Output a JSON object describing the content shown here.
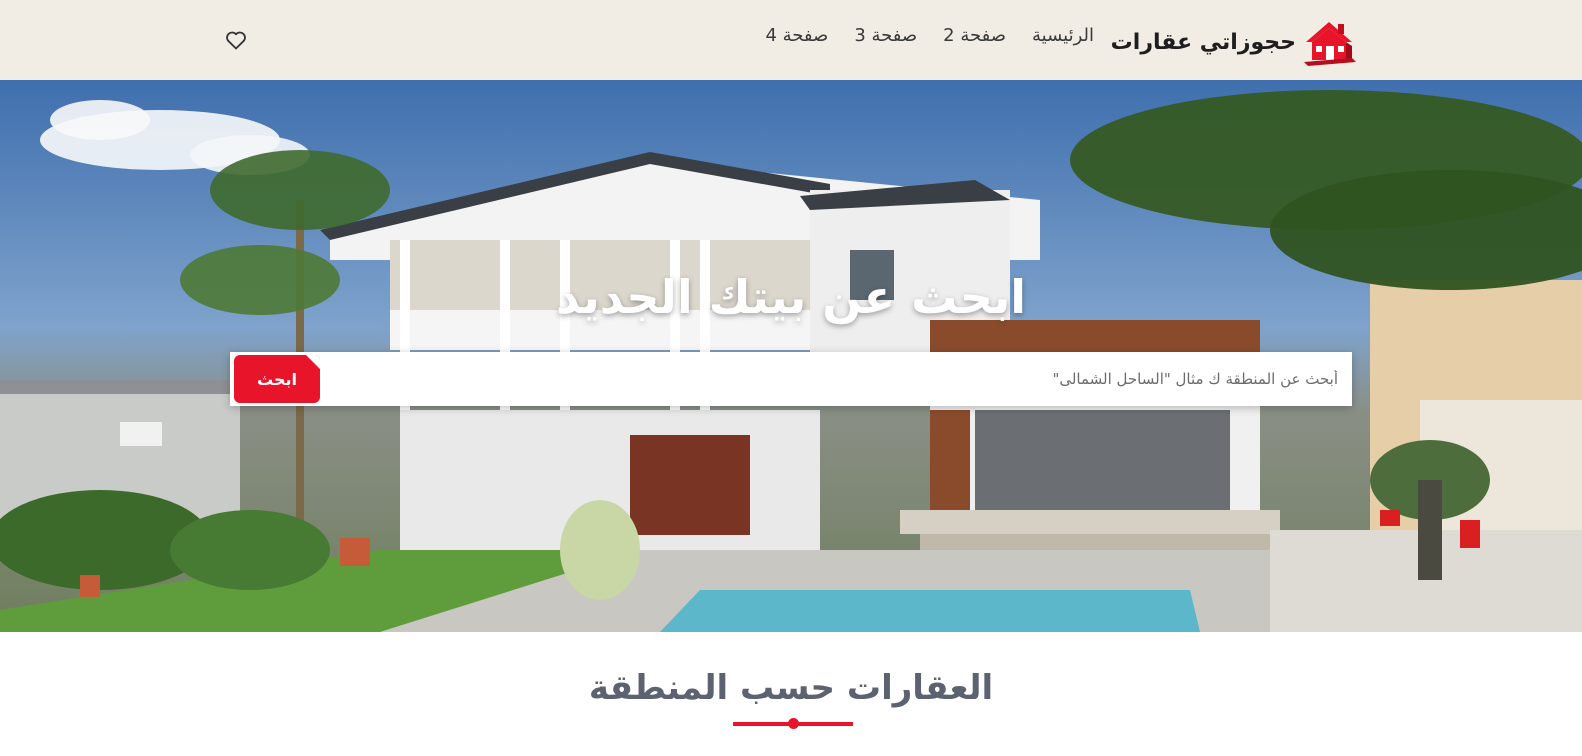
{
  "header": {
    "brand_name": "حجوزاتي عقارات",
    "nav": [
      "الرئيسية",
      "صفحة 2",
      "صفحة 3",
      "صفحة 4"
    ]
  },
  "hero": {
    "title": "ابحث عن بيتك الجديد",
    "search": {
      "placeholder": "أبحث عن المنطقة ك مثال \"الساحل الشمالى\"",
      "value": "",
      "button_label": "ابحث"
    }
  },
  "section": {
    "title": "العقارات حسب المنطقة"
  },
  "colors": {
    "accent": "#e8152a",
    "header_bg": "#f1ede4",
    "section_title": "#5d6270"
  },
  "icons": {
    "logo": "house-logo-icon",
    "favorite": "heart-icon"
  }
}
